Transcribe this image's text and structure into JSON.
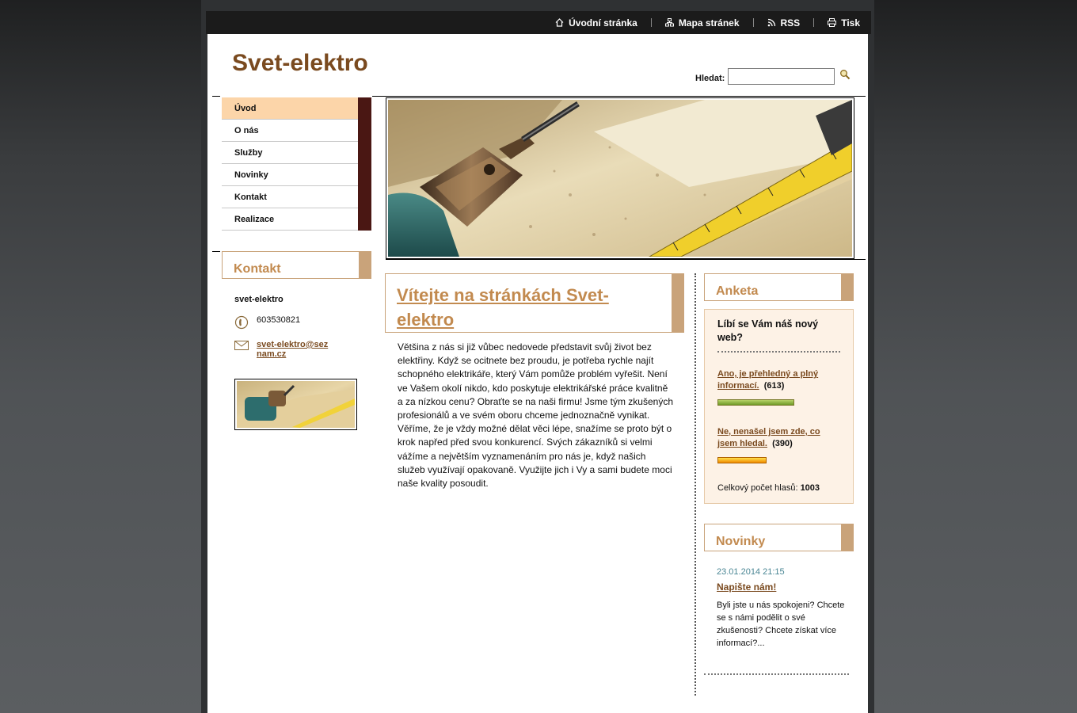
{
  "topnav": {
    "home": "Úvodní stránka",
    "sitemap": "Mapa stránek",
    "rss": "RSS",
    "print": "Tisk"
  },
  "header": {
    "title": "Svet-elektro",
    "search_label": "Hledat:",
    "search_value": "",
    "search_icon": "magnifier-icon"
  },
  "menu": {
    "items": [
      {
        "label": "Úvod",
        "active": true
      },
      {
        "label": "O nás"
      },
      {
        "label": "Služby"
      },
      {
        "label": "Novinky"
      },
      {
        "label": "Kontakt"
      },
      {
        "label": "Realizace"
      }
    ]
  },
  "contact": {
    "heading": "Kontakt",
    "name": "svet-elektro",
    "phone": "603530821",
    "email_line1": "svet-elektro@sez",
    "email_line2": "nam.cz"
  },
  "article": {
    "title": "Vítejte na stránkách Svet-elektro",
    "body": "Většina z nás si již vůbec nedovede představit svůj život bez elektřiny. Když se ocitnete bez proudu, je potřeba rychle najít schopného elektrikáře, který Vám pomůže problém vyřešit. Není ve Vašem okolí nikdo, kdo poskytuje elektrikářské práce kvalitně a za nízkou cenu? Obraťte se na naši firmu! Jsme tým zkušených profesionálů a ve svém oboru chceme jednoznačně vynikat. Věříme, že je vždy možné dělat věci lépe, snažíme se proto být o krok napřed před svou konkurencí. Svých zákazníků si velmi vážíme a největším vyznamenáním pro nás je, když našich služeb využívají opakovaně. Využijte jich i Vy a sami budete moci naše kvality posoudit."
  },
  "poll": {
    "heading": "Anketa",
    "question": "Líbí se Vám náš nový web?",
    "options": [
      {
        "label": "Ano, je přehledný a plný informací.",
        "count": "(613)",
        "share": 0.61
      },
      {
        "label": "Ne, nenašel jsem zde, co jsem hledal.",
        "count": "(390)",
        "share": 0.39
      }
    ],
    "total_label": "Celkový počet hlasů:",
    "total": "1003"
  },
  "news": {
    "heading": "Novinky",
    "date": "23.01.2014 21:15",
    "title": "Napište nám!",
    "text": "Byli jste u nás spokojeni? Chcete se s námi podělit o své zkušenosti? Chcete získat více informací?..."
  },
  "colors": {
    "brand_brown": "#7a4a1f",
    "accent_tan": "#c9a37a",
    "menu_active": "#fcd5a9",
    "menu_tab": "#4a1713"
  }
}
